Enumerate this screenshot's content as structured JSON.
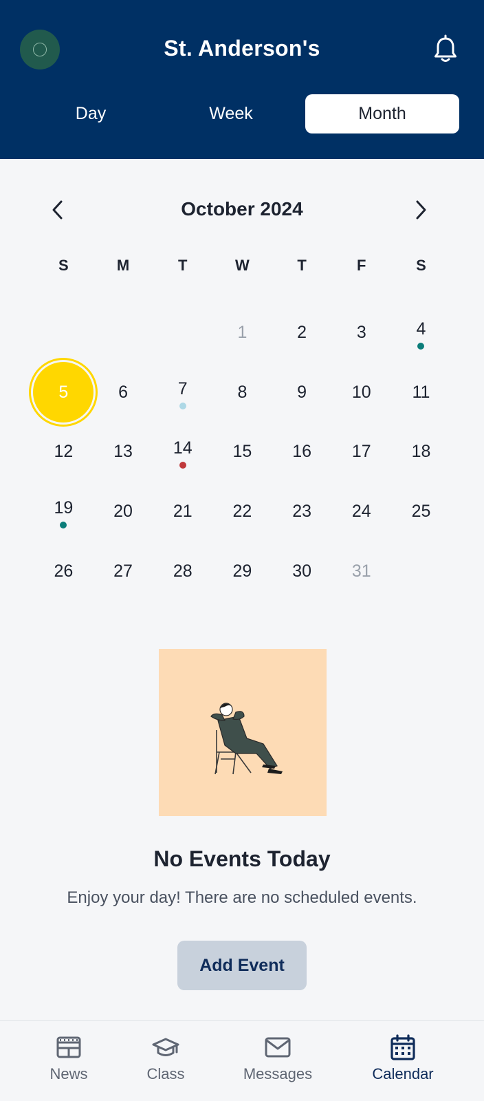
{
  "header": {
    "title": "St. Anderson's",
    "logo_icon": "school-logo-icon",
    "notification_icon": "bell-icon",
    "background": "#003064"
  },
  "view_tabs": [
    {
      "label": "Day",
      "active": false
    },
    {
      "label": "Week",
      "active": false
    },
    {
      "label": "Month",
      "active": true
    }
  ],
  "calendar": {
    "month_label": "October 2024",
    "prev_icon": "chevron-left-icon",
    "next_icon": "chevron-right-icon",
    "weekdays": [
      "S",
      "M",
      "T",
      "W",
      "T",
      "F",
      "S"
    ],
    "selected_day": "5",
    "selected_color": "#ffd700",
    "leading_blanks": 3,
    "days": [
      {
        "d": "1",
        "muted": true,
        "dot": null
      },
      {
        "d": "2",
        "muted": false,
        "dot": null
      },
      {
        "d": "3",
        "muted": false,
        "dot": null
      },
      {
        "d": "4",
        "muted": false,
        "dot": "#0b7d7a"
      },
      {
        "d": "5",
        "muted": false,
        "dot": null
      },
      {
        "d": "6",
        "muted": false,
        "dot": null
      },
      {
        "d": "7",
        "muted": false,
        "dot": "#add8e6"
      },
      {
        "d": "8",
        "muted": false,
        "dot": null
      },
      {
        "d": "9",
        "muted": false,
        "dot": null
      },
      {
        "d": "10",
        "muted": false,
        "dot": null
      },
      {
        "d": "11",
        "muted": false,
        "dot": null
      },
      {
        "d": "12",
        "muted": false,
        "dot": null
      },
      {
        "d": "13",
        "muted": false,
        "dot": null
      },
      {
        "d": "14",
        "muted": false,
        "dot": "#c0393b"
      },
      {
        "d": "15",
        "muted": false,
        "dot": null
      },
      {
        "d": "16",
        "muted": false,
        "dot": null
      },
      {
        "d": "17",
        "muted": false,
        "dot": null
      },
      {
        "d": "18",
        "muted": false,
        "dot": null
      },
      {
        "d": "19",
        "muted": false,
        "dot": "#0b7d7a"
      },
      {
        "d": "20",
        "muted": false,
        "dot": null
      },
      {
        "d": "21",
        "muted": false,
        "dot": null
      },
      {
        "d": "22",
        "muted": false,
        "dot": null
      },
      {
        "d": "23",
        "muted": false,
        "dot": null
      },
      {
        "d": "24",
        "muted": false,
        "dot": null
      },
      {
        "d": "25",
        "muted": false,
        "dot": null
      },
      {
        "d": "26",
        "muted": false,
        "dot": null
      },
      {
        "d": "27",
        "muted": false,
        "dot": null
      },
      {
        "d": "28",
        "muted": false,
        "dot": null
      },
      {
        "d": "29",
        "muted": false,
        "dot": null
      },
      {
        "d": "30",
        "muted": false,
        "dot": null
      },
      {
        "d": "31",
        "muted": true,
        "dot": null
      }
    ]
  },
  "empty_state": {
    "illustration_icon": "person-relaxing-illustration",
    "illustration_bg": "#fddbb5",
    "title": "No Events Today",
    "message": "Enjoy your day! There are no scheduled events.",
    "button_label": "Add Event"
  },
  "bottom_nav": [
    {
      "label": "News",
      "icon": "newspaper-icon",
      "active": false
    },
    {
      "label": "Class",
      "icon": "graduation-cap-icon",
      "active": false
    },
    {
      "label": "Messages",
      "icon": "envelope-icon",
      "active": false
    },
    {
      "label": "Calendar",
      "icon": "calendar-icon",
      "active": true
    }
  ]
}
